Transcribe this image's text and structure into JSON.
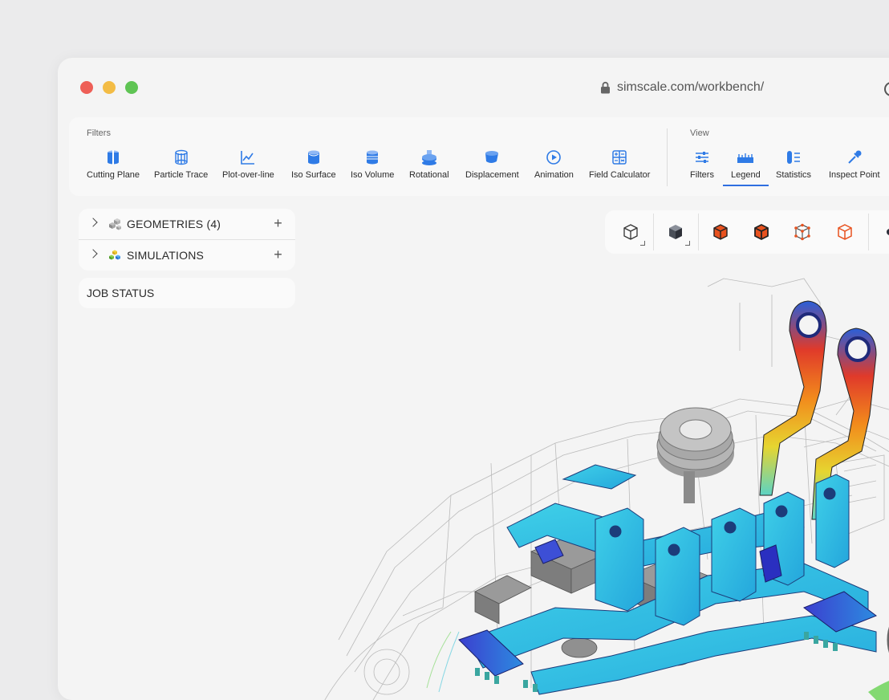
{
  "browser": {
    "url": "simscale.com/workbench/",
    "lock_icon": "lock-icon",
    "reload_icon": "reload-icon"
  },
  "toolbar": {
    "filters_label": "Filters",
    "view_label": "View",
    "filters": [
      {
        "label": "Cutting Plane",
        "icon": "cutting-plane-icon"
      },
      {
        "label": "Particle Trace",
        "icon": "particle-trace-icon"
      },
      {
        "label": "Plot-over-line",
        "icon": "plot-over-line-icon"
      },
      {
        "label": "Iso Surface",
        "icon": "iso-surface-icon"
      },
      {
        "label": "Iso Volume",
        "icon": "iso-volume-icon"
      },
      {
        "label": "Rotational",
        "icon": "rotational-icon"
      },
      {
        "label": "Displacement",
        "icon": "displacement-icon"
      },
      {
        "label": "Animation",
        "icon": "animation-icon"
      },
      {
        "label": "Field Calculator",
        "icon": "field-calculator-icon"
      }
    ],
    "view": [
      {
        "label": "Filters",
        "icon": "filters-sliders-icon"
      },
      {
        "label": "Legend",
        "icon": "legend-icon",
        "active": true
      },
      {
        "label": "Statistics",
        "icon": "statistics-icon"
      },
      {
        "label": "Inspect Point",
        "icon": "inspect-point-icon"
      }
    ]
  },
  "tree": {
    "geometries_label": "GEOMETRIES",
    "geometries_count": "(4)",
    "simulations_label": "SIMULATIONS",
    "job_status_label": "JOB STATUS"
  },
  "colors": {
    "accent": "#2f6fe0",
    "icon_blue": "#2f7be6",
    "icon_orange": "#e8521f",
    "traffic_red": "#ee5f57",
    "traffic_yellow": "#f3bc45",
    "traffic_green": "#5fc454"
  }
}
